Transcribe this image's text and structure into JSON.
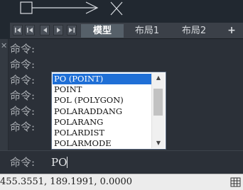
{
  "tabs": {
    "nav_icons": [
      "first-icon",
      "prev-icon",
      "prev-small-icon",
      "next-icon",
      "last-icon"
    ],
    "items": [
      {
        "label": "模型",
        "active": true
      },
      {
        "label": "布局1",
        "active": false
      },
      {
        "label": "布局2",
        "active": false
      }
    ],
    "add_label": "+"
  },
  "command": {
    "history": [
      "命令:",
      "命令:",
      "命令:",
      "命令:",
      "命令:",
      "命令:"
    ],
    "prompt": "命令:",
    "input_value": "PO"
  },
  "autocomplete": {
    "items": [
      "PO (POINT)",
      "POINT",
      "POL (POLYGON)",
      "POLARADDANG",
      "POLARANG",
      "POLARDIST",
      "POLARMODE"
    ],
    "selected_index": 0
  },
  "status": {
    "coordinates": "455.3551, 189.1991, 0.0000"
  },
  "colors": {
    "selection": "#1f6fd6",
    "background": "#212830"
  }
}
